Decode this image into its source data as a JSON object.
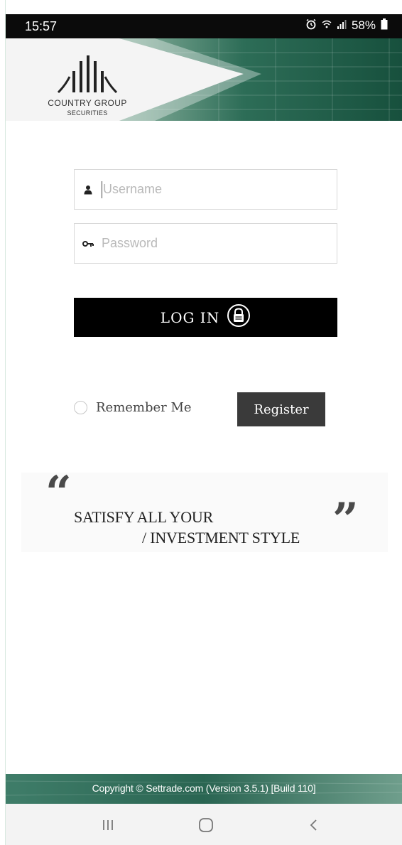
{
  "status_bar": {
    "time": "15:57",
    "battery_text": "58%"
  },
  "brand": {
    "line1": "COUNTRY GROUP",
    "line2": "SECURITIES"
  },
  "form": {
    "username_placeholder": "Username",
    "password_placeholder": "Password",
    "login_label": "LOG IN",
    "remember_label": "Remember Me",
    "register_label": "Register"
  },
  "quote": {
    "line1": "SATISFY ALL YOUR",
    "line2": "/ INVESTMENT STYLE"
  },
  "footer": {
    "copyright": "Copyright © Settrade.com (Version 3.5.1) [Build 110]"
  },
  "icons": {
    "user": "user-icon",
    "key": "key-icon",
    "lock": "lock-icon",
    "alarm": "alarm-icon",
    "signal": "signal-icon",
    "battery": "battery-icon"
  },
  "colors": {
    "accent_green": "#1e5a45",
    "button_black": "#000000",
    "register_gray": "#3a3a3a"
  }
}
